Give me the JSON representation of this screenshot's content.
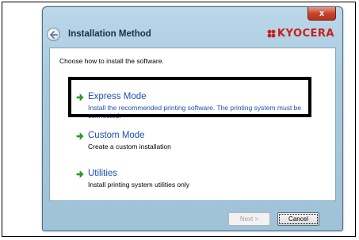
{
  "window": {
    "title": "Installation Method",
    "brand": "KYOCERA",
    "close_label": "x"
  },
  "content": {
    "prompt": "Choose how to install the software.",
    "options": [
      {
        "label": "Express Mode",
        "description": "Install the recommended printing software. The printing system must be connected."
      },
      {
        "label": "Custom Mode",
        "description": "Create a custom installation"
      },
      {
        "label": "Utilities",
        "description": "Install printing system utilities only"
      }
    ]
  },
  "footer": {
    "next_label": "Next >",
    "cancel_label": "Cancel"
  },
  "colors": {
    "brand": "#cc1e16",
    "link": "#1f4eb4",
    "arrow": "#2aa52a"
  }
}
